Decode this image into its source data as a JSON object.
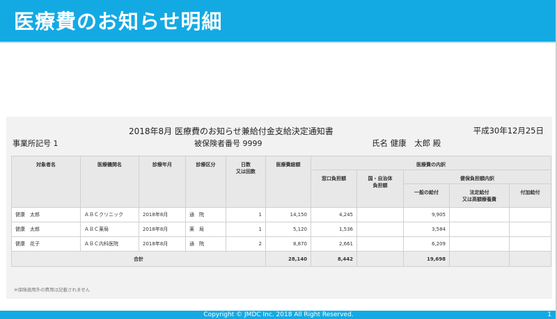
{
  "header": {
    "title": "医療費のお知らせ明細"
  },
  "document": {
    "title": "2018年8月 医療費のお知らせ兼給付金支給決定通知書",
    "date": "平成30年12月25日",
    "office_label": "事業所記号 1",
    "insured_number_label": "被保険者番号 9999",
    "name_line": "氏名 健康　太郎 殿"
  },
  "table": {
    "headers": {
      "person": "対象者名",
      "institution": "医療機関名",
      "month": "診療年月",
      "category": "診療区分",
      "days": "日数\n又は回数",
      "total": "医療費総額",
      "breakdown": "医療費の内訳",
      "window": "窓口負担額",
      "public": "国・自治体\n負担額",
      "insurance": "健保負担額内訳",
      "general": "一般の給付",
      "statutory": "法定給付\n又は高額療養費",
      "additional": "付加給付"
    },
    "rows": [
      {
        "person": "健康　太郎",
        "institution": "ＡＢＣクリニック",
        "month": "2018年8月",
        "category": "通　院",
        "days": "1",
        "total": "14,150",
        "window": "4,245",
        "public": "",
        "general": "9,905",
        "statutory": "",
        "additional": ""
      },
      {
        "person": "健康　太郎",
        "institution": "ＡＢＣ薬局",
        "month": "2018年8月",
        "category": "薬　局",
        "days": "1",
        "total": "5,120",
        "window": "1,536",
        "public": "",
        "general": "3,584",
        "statutory": "",
        "additional": ""
      },
      {
        "person": "健康　花子",
        "institution": "ＡＢＣ内科医院",
        "month": "2018年8月",
        "category": "通　院",
        "days": "2",
        "total": "8,870",
        "window": "2,661",
        "public": "",
        "general": "6,209",
        "statutory": "",
        "additional": ""
      }
    ],
    "total_row": {
      "label": "合計",
      "total": "28,140",
      "window": "8,442",
      "public": "",
      "general": "19,698",
      "statutory": "",
      "additional": ""
    }
  },
  "note": "※保険適用外の費用は記載されません",
  "footer": {
    "copyright": "Copyright © JMDC Inc. 2018 All Right Reserved.",
    "page_number": "1"
  }
}
